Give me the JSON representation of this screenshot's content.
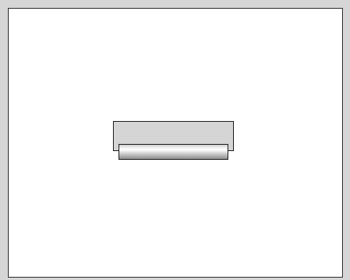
{
  "colors": {
    "backdrop": "#d6d6d6",
    "canvas": "#ffffff",
    "outline": "#1e1e1e",
    "tray_fill": "#d5d5d5"
  },
  "icons": {
    "center_object": "tray-with-roller-icon"
  }
}
